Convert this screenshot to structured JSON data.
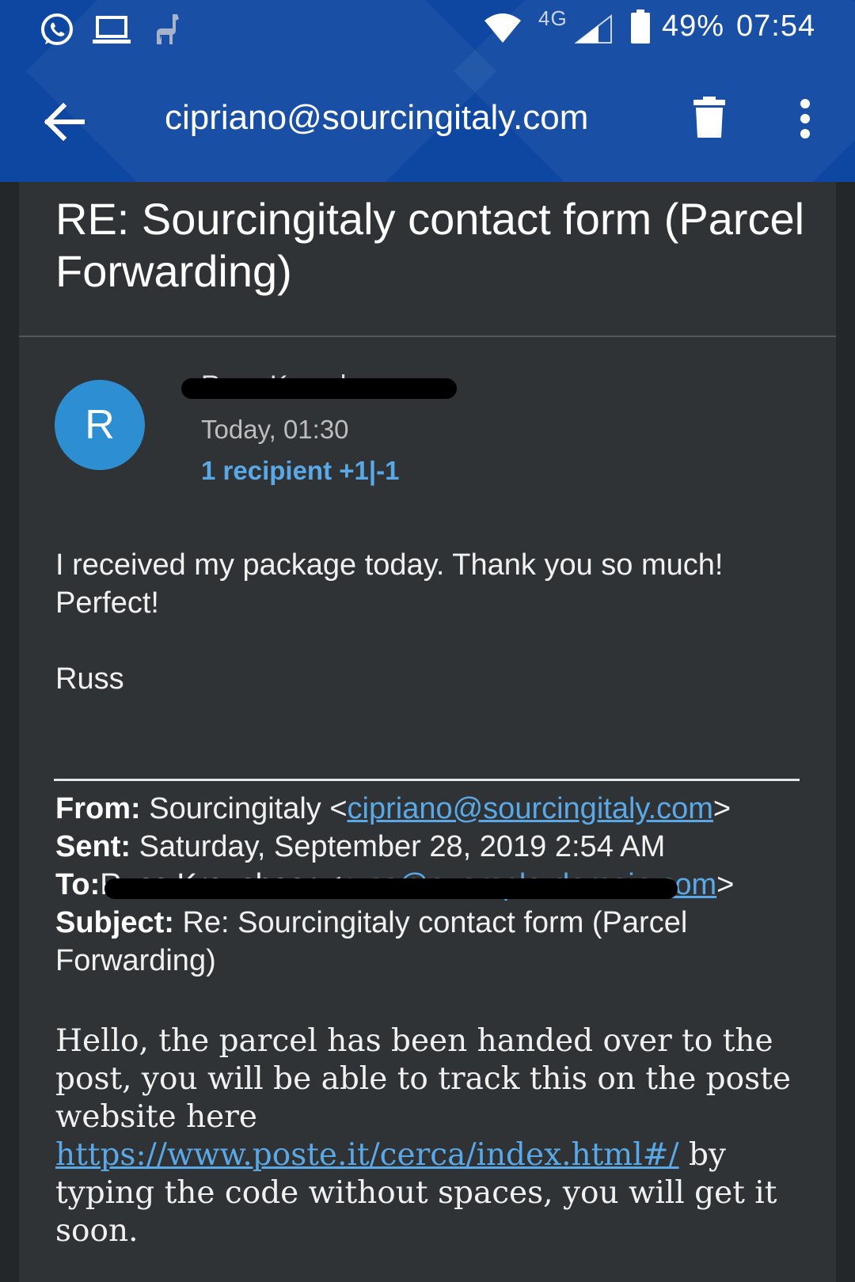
{
  "status_bar": {
    "network": "4G",
    "battery": "49%",
    "time": "07:54",
    "icons": [
      "whatsapp-icon",
      "laptop-icon",
      "llama-icon",
      "wifi-icon",
      "signal-icon",
      "battery-icon"
    ]
  },
  "app_bar": {
    "title": "cipriano@sourcingitaly.com",
    "icons": [
      "back-arrow-icon",
      "trash-icon",
      "more-vert-icon"
    ]
  },
  "email": {
    "subject": "RE: Sourcingitaly contact form (Parcel Forwarding)",
    "avatar_letter": "R",
    "sender_name": "Russ Kraushaar",
    "date": "Today, 01:30",
    "recipients": "1 recipient +1|-1",
    "body_lines": [
      "I received my package today. Thank you so much!",
      "Perfect!",
      "Russ"
    ],
    "quoted": {
      "from_label": "From:",
      "from_name": "Sourcingitaly <",
      "from_email": "cipriano@sourcingitaly.com",
      "from_close": ">",
      "sent_label": "Sent:",
      "sent_value": "Saturday, September 28, 2019 2:54 AM",
      "to_label": "To:",
      "to_name": "Russ Kraushaar <",
      "to_email": "russ@example-domain.com",
      "to_close": ">",
      "subject_label": "Subject:",
      "subject_value": "Re: Sourcingitaly contact form (Parcel Forwarding)",
      "message_start": "Hello, the parcel has been handed over to the post, you will be able to track this on the poste website here",
      "message_link": "https://www.poste.it/cerca/index.html#/",
      "message_end": "by typing the code without spaces, you will get it soon."
    }
  },
  "colors": {
    "app_bar": "#0d47a1",
    "background": "#24272a",
    "card": "#303336",
    "avatar": "#2d8fd1",
    "link": "#5aa9e6"
  }
}
